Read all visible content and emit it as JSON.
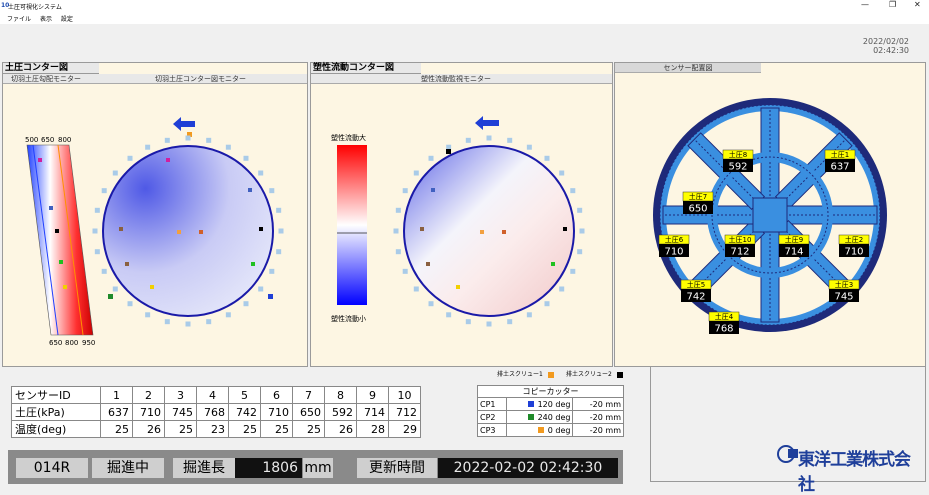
{
  "window": {
    "title": "土圧可視化システム",
    "icon": "app-logo-icon"
  },
  "menu": [
    "ファイル",
    "表示",
    "設定"
  ],
  "datetime": {
    "date": "2022/02/02",
    "time": "02:42:30"
  },
  "panel1": {
    "title": "土圧コンター図",
    "sub_left": "切羽土圧勾配モニター",
    "sub_right": "切羽土圧コンター図モニター",
    "gradient_top_labels": [
      "500",
      "650",
      "800"
    ],
    "gradient_bottom_labels": [
      "650",
      "800",
      "950"
    ]
  },
  "panel2": {
    "title": "塑性流動コンター図",
    "sub": "塑性流動監視モニター",
    "scale_top": "塑性流動大",
    "scale_bottom": "塑性流動小"
  },
  "panel3": {
    "title": "センサー配置図",
    "sensors": [
      {
        "label": "土圧8",
        "value": "592"
      },
      {
        "label": "土圧1",
        "value": "637"
      },
      {
        "label": "土圧7",
        "value": "650"
      },
      {
        "label": "土圧6",
        "value": "710"
      },
      {
        "label": "土圧10",
        "value": "712"
      },
      {
        "label": "土圧9",
        "value": "714"
      },
      {
        "label": "土圧2",
        "value": "710"
      },
      {
        "label": "土圧5",
        "value": "742"
      },
      {
        "label": "土圧3",
        "value": "745"
      },
      {
        "label": "土圧4",
        "value": "768"
      }
    ]
  },
  "legend": {
    "screw1": "排土スクリュー1",
    "screw2": "排土スクリュー2"
  },
  "sensor_table": {
    "header": [
      "センサーID",
      "1",
      "2",
      "3",
      "4",
      "5",
      "6",
      "7",
      "8",
      "9",
      "10"
    ],
    "rows": [
      [
        "土圧(kPa)",
        "637",
        "710",
        "745",
        "768",
        "742",
        "710",
        "650",
        "592",
        "714",
        "712"
      ],
      [
        "温度(deg)",
        "25",
        "26",
        "25",
        "23",
        "25",
        "25",
        "25",
        "26",
        "28",
        "29"
      ]
    ]
  },
  "copy_cutter": {
    "title": "コピーカッター",
    "rows": [
      {
        "id": "CP1",
        "color": "#1f3fd6",
        "angle": "120 deg",
        "stroke": "-20 mm"
      },
      {
        "id": "CP2",
        "color": "#1f8a2a",
        "angle": "240 deg",
        "stroke": "-20 mm"
      },
      {
        "id": "CP3",
        "color": "#f29a1f",
        "angle": "0 deg",
        "stroke": "-20 mm"
      }
    ]
  },
  "status": {
    "ring": "014R",
    "state": "掘進中",
    "length_label": "掘進長",
    "length_value": "1806",
    "length_unit": "mm",
    "update_label": "更新時間",
    "update_value": "2022-02-02 02:42:30"
  },
  "company": "東洋工業株式会社",
  "colors": {
    "accent_blue": "#2424c8",
    "orange": "#f29a1f",
    "sensor_box": "#ffff00"
  }
}
